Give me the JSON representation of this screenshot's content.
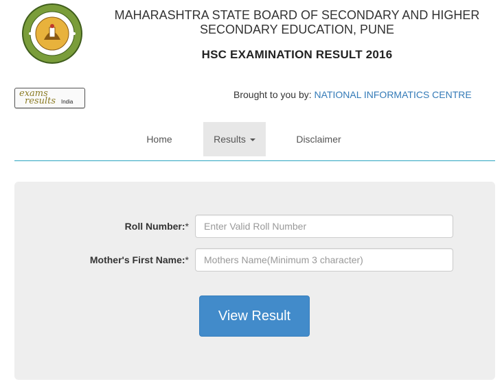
{
  "header": {
    "board_title_line1": "MAHARASHTRA STATE BOARD OF SECONDARY AND HIGHER",
    "board_title_line2": "SECONDARY EDUCATION, PUNE",
    "exam_title": "HSC EXAMINATION RESULT 2016",
    "emblem_icon": "maharashtra-board-emblem-icon"
  },
  "sponsor": {
    "logo_line1": "exams",
    "logo_line2": "results",
    "logo_line3": "India",
    "brought_label": "Brought to you by:",
    "organization": "NATIONAL INFORMATICS CENTRE"
  },
  "nav": {
    "home": "Home",
    "results": "Results",
    "disclaimer": "Disclaimer"
  },
  "form": {
    "roll_label": "Roll Number:",
    "roll_required": "*",
    "roll_placeholder": "Enter Valid Roll Number",
    "roll_value": "",
    "mother_label": "Mother's First Name:",
    "mother_required": "*",
    "mother_placeholder": "Mothers Name(Minimum 3 character)",
    "mother_value": "",
    "submit_label": "View Result"
  },
  "colors": {
    "link": "#337ab7",
    "button": "#428bca",
    "nav_underline": "#2aa3c0",
    "panel": "#eeeeee"
  }
}
